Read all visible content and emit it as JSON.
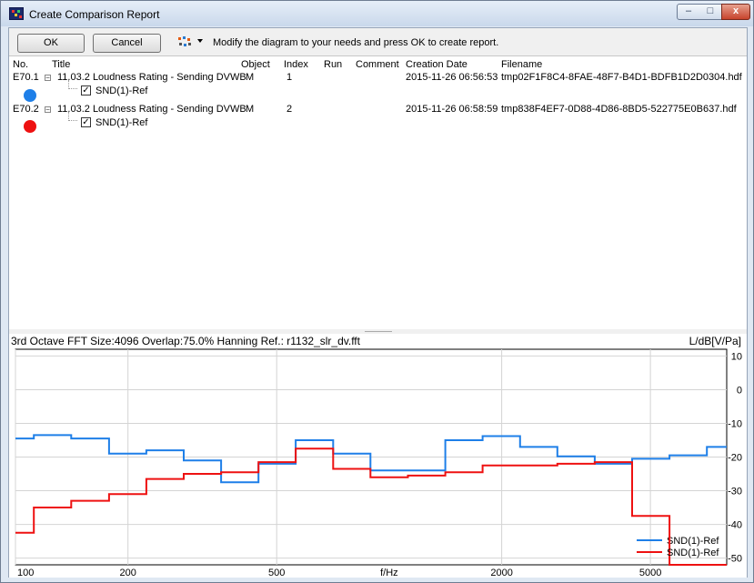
{
  "window": {
    "title": "Create Comparison Report",
    "controls": {
      "minimize": "–",
      "maximize": "□",
      "close": "x"
    }
  },
  "toolbar": {
    "ok_label": "OK",
    "cancel_label": "Cancel",
    "tool_icon": "graph-settings-icon",
    "hint": "Modify the diagram to your needs and press OK to create report."
  },
  "table": {
    "columns": [
      "No.",
      "Title",
      "Object",
      "Index",
      "Run",
      "Comment",
      "Creation Date",
      "Filename"
    ],
    "rows": [
      {
        "no": "E70.1",
        "title": "11.03.2 Loudness Rating - Sending DVWB",
        "object": "M",
        "index": "1",
        "run": "",
        "comment": "",
        "creation_date": "2015-11-26 06:56:53",
        "filename": "tmp02F1F8C4-8FAE-48F7-B4D1-BDFB1D2D0304.hdf",
        "child": "SND(1)-Ref",
        "color": "#1e7fe8"
      },
      {
        "no": "E70.2",
        "title": "11.03.2 Loudness Rating - Sending DVWB",
        "object": "M",
        "index": "2",
        "run": "",
        "comment": "",
        "creation_date": "2015-11-26 06:58:59",
        "filename": "tmp838F4EF7-0D88-4D86-8BD5-522775E0B637.hdf",
        "child": "SND(1)-Ref",
        "color": "#ee1111"
      }
    ]
  },
  "chart_panel": {
    "subtitle": "3rd Octave  FFT Size:4096  Overlap:75.0%  Hanning    Ref.: r1132_slr_dv.fft",
    "y_unit": "L/dB[V/Pa]"
  },
  "chart_data": {
    "type": "line",
    "xlabel": "f/Hz",
    "ylabel": "L/dB[V/Pa]",
    "x_scale": "log",
    "xlim": [
      100,
      8000
    ],
    "ylim": [
      -52,
      12
    ],
    "x_ticks": [
      100,
      200,
      500,
      2000,
      5000
    ],
    "x_tick_labels": [
      "100",
      "200",
      "500",
      "2000",
      "5000"
    ],
    "y_ticks": [
      10,
      0,
      -10,
      -20,
      -30,
      -40,
      -50
    ],
    "y_tick_labels": [
      "10",
      "0",
      "-10",
      "-20",
      "-30",
      "-40",
      "-50"
    ],
    "grid": true,
    "legend_position": "bottom-right",
    "step": true,
    "edges": [
      100,
      112,
      141,
      178,
      224,
      282,
      355,
      447,
      562,
      708,
      891,
      1122,
      1413,
      1778,
      2239,
      2818,
      3548,
      4467,
      5623,
      7079,
      8000
    ],
    "series": [
      {
        "name": "SND(1)-Ref",
        "color": "#1e7fe8",
        "values": [
          -14.5,
          -13.5,
          -14.5,
          -19,
          -18,
          -21,
          -27.5,
          -22,
          -15,
          -19,
          -24,
          -24,
          -15,
          -13.8,
          -17,
          -19.8,
          -22,
          -20.5,
          -19.5,
          -17
        ]
      },
      {
        "name": "SND(1)-Ref",
        "color": "#ee1111",
        "values": [
          -42.5,
          -35,
          -33,
          -31,
          -26.5,
          -25,
          -24.5,
          -21.5,
          -17.5,
          -23.5,
          -26,
          -25.5,
          -24.5,
          -22.5,
          -22.5,
          -22,
          -21.5,
          -37.5,
          -52,
          -52
        ]
      }
    ]
  }
}
